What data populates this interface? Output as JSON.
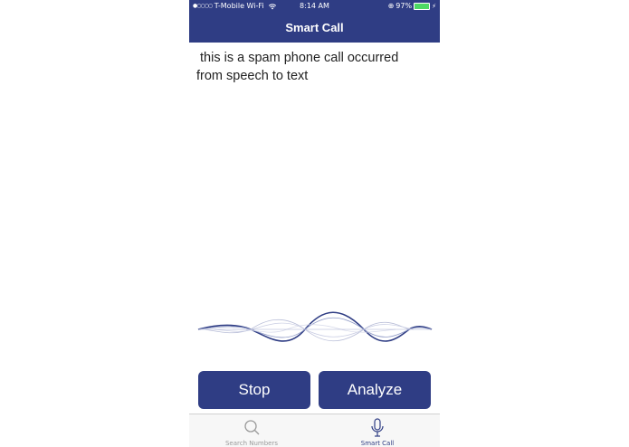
{
  "status_bar": {
    "signal_dots": "●○○○○",
    "carrier": "T-Mobile Wi-Fi",
    "time": "8:14 AM",
    "battery": "97%",
    "battery_level": 0.97
  },
  "nav": {
    "title": "Smart Call"
  },
  "transcript": {
    "text": " this is a spam phone call occurred\nfrom speech to text"
  },
  "actions": {
    "stop_label": "Stop",
    "analyze_label": "Analyze"
  },
  "tabbar": {
    "items": [
      {
        "label": "Search Numbers",
        "icon": "search-icon",
        "active": false
      },
      {
        "label": "Smart Call",
        "icon": "microphone-icon",
        "active": true
      }
    ]
  },
  "colors": {
    "accent": "#2f3d84",
    "battery_fill": "#4cd964",
    "inactive_tab": "#9a9a9a"
  }
}
